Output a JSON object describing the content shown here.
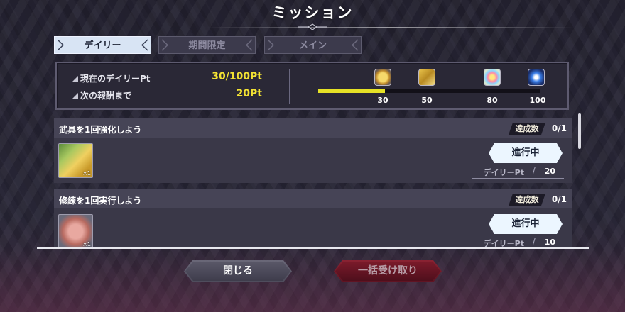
{
  "header": {
    "title": "ミッション"
  },
  "tabs": [
    {
      "label": "デイリー",
      "active": true
    },
    {
      "label": "期間限定",
      "active": false
    },
    {
      "label": "メイン",
      "active": false
    }
  ],
  "summary": {
    "current_label": "現在のデイリーPt",
    "current_value": "30/100Pt",
    "next_label": "次の報酬まで",
    "next_value": "20Pt",
    "progress": 0.3,
    "milestones": [
      {
        "value": "30",
        "icon": "gold-medal-icon"
      },
      {
        "value": "50",
        "icon": "gold-ticket-icon"
      },
      {
        "value": "80",
        "icon": "rainbow-orb-icon"
      },
      {
        "value": "100",
        "icon": "blue-crystal-icon"
      }
    ]
  },
  "missions": [
    {
      "title": "武具を1回強化しよう",
      "badge": "達成数",
      "count": "0/1",
      "reward_icon": "gold-ticket-icon",
      "reward_qty": "×1",
      "status": "進行中",
      "pt_label": "デイリーPt",
      "pt_value": "20"
    },
    {
      "title": "修練を1回実行しよう",
      "badge": "達成数",
      "count": "0/1",
      "reward_icon": "bronze-medal-icon",
      "reward_qty": "×1",
      "status": "進行中",
      "pt_label": "デイリーPt",
      "pt_value": "10"
    }
  ],
  "buttons": {
    "close": "閉じる",
    "claim_all": "一括受け取り"
  },
  "colors": {
    "accent_yellow": "#f2e233",
    "claim_red": "#7a1a2a",
    "tab_active": "#d8e4f4"
  }
}
